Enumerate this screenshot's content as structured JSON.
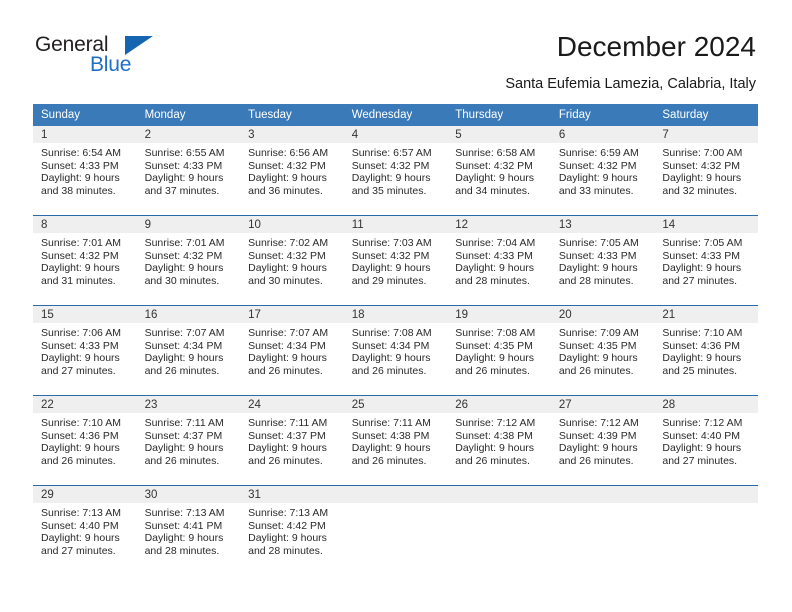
{
  "brand": {
    "name_top": "General",
    "name_bottom": "Blue",
    "triangle_color": "#1565b0",
    "text_color_top": "#231f20",
    "text_color_bottom": "#1f6fc4"
  },
  "header": {
    "title": "December 2024",
    "subtitle": "Santa Eufemia Lamezia, Calabria, Italy"
  },
  "theme": {
    "header_bg": "#3a7ab8",
    "header_text": "#ffffff",
    "daynum_band_bg": "#efefef",
    "row_divider": "#2b6ca8",
    "body_text": "#2a2a2a"
  },
  "weekdays": [
    "Sunday",
    "Monday",
    "Tuesday",
    "Wednesday",
    "Thursday",
    "Friday",
    "Saturday"
  ],
  "weeks": [
    [
      {
        "day": "1",
        "sunrise": "Sunrise: 6:54 AM",
        "sunset": "Sunset: 4:33 PM",
        "daylight1": "Daylight: 9 hours",
        "daylight2": "and 38 minutes."
      },
      {
        "day": "2",
        "sunrise": "Sunrise: 6:55 AM",
        "sunset": "Sunset: 4:33 PM",
        "daylight1": "Daylight: 9 hours",
        "daylight2": "and 37 minutes."
      },
      {
        "day": "3",
        "sunrise": "Sunrise: 6:56 AM",
        "sunset": "Sunset: 4:32 PM",
        "daylight1": "Daylight: 9 hours",
        "daylight2": "and 36 minutes."
      },
      {
        "day": "4",
        "sunrise": "Sunrise: 6:57 AM",
        "sunset": "Sunset: 4:32 PM",
        "daylight1": "Daylight: 9 hours",
        "daylight2": "and 35 minutes."
      },
      {
        "day": "5",
        "sunrise": "Sunrise: 6:58 AM",
        "sunset": "Sunset: 4:32 PM",
        "daylight1": "Daylight: 9 hours",
        "daylight2": "and 34 minutes."
      },
      {
        "day": "6",
        "sunrise": "Sunrise: 6:59 AM",
        "sunset": "Sunset: 4:32 PM",
        "daylight1": "Daylight: 9 hours",
        "daylight2": "and 33 minutes."
      },
      {
        "day": "7",
        "sunrise": "Sunrise: 7:00 AM",
        "sunset": "Sunset: 4:32 PM",
        "daylight1": "Daylight: 9 hours",
        "daylight2": "and 32 minutes."
      }
    ],
    [
      {
        "day": "8",
        "sunrise": "Sunrise: 7:01 AM",
        "sunset": "Sunset: 4:32 PM",
        "daylight1": "Daylight: 9 hours",
        "daylight2": "and 31 minutes."
      },
      {
        "day": "9",
        "sunrise": "Sunrise: 7:01 AM",
        "sunset": "Sunset: 4:32 PM",
        "daylight1": "Daylight: 9 hours",
        "daylight2": "and 30 minutes."
      },
      {
        "day": "10",
        "sunrise": "Sunrise: 7:02 AM",
        "sunset": "Sunset: 4:32 PM",
        "daylight1": "Daylight: 9 hours",
        "daylight2": "and 30 minutes."
      },
      {
        "day": "11",
        "sunrise": "Sunrise: 7:03 AM",
        "sunset": "Sunset: 4:32 PM",
        "daylight1": "Daylight: 9 hours",
        "daylight2": "and 29 minutes."
      },
      {
        "day": "12",
        "sunrise": "Sunrise: 7:04 AM",
        "sunset": "Sunset: 4:33 PM",
        "daylight1": "Daylight: 9 hours",
        "daylight2": "and 28 minutes."
      },
      {
        "day": "13",
        "sunrise": "Sunrise: 7:05 AM",
        "sunset": "Sunset: 4:33 PM",
        "daylight1": "Daylight: 9 hours",
        "daylight2": "and 28 minutes."
      },
      {
        "day": "14",
        "sunrise": "Sunrise: 7:05 AM",
        "sunset": "Sunset: 4:33 PM",
        "daylight1": "Daylight: 9 hours",
        "daylight2": "and 27 minutes."
      }
    ],
    [
      {
        "day": "15",
        "sunrise": "Sunrise: 7:06 AM",
        "sunset": "Sunset: 4:33 PM",
        "daylight1": "Daylight: 9 hours",
        "daylight2": "and 27 minutes."
      },
      {
        "day": "16",
        "sunrise": "Sunrise: 7:07 AM",
        "sunset": "Sunset: 4:34 PM",
        "daylight1": "Daylight: 9 hours",
        "daylight2": "and 26 minutes."
      },
      {
        "day": "17",
        "sunrise": "Sunrise: 7:07 AM",
        "sunset": "Sunset: 4:34 PM",
        "daylight1": "Daylight: 9 hours",
        "daylight2": "and 26 minutes."
      },
      {
        "day": "18",
        "sunrise": "Sunrise: 7:08 AM",
        "sunset": "Sunset: 4:34 PM",
        "daylight1": "Daylight: 9 hours",
        "daylight2": "and 26 minutes."
      },
      {
        "day": "19",
        "sunrise": "Sunrise: 7:08 AM",
        "sunset": "Sunset: 4:35 PM",
        "daylight1": "Daylight: 9 hours",
        "daylight2": "and 26 minutes."
      },
      {
        "day": "20",
        "sunrise": "Sunrise: 7:09 AM",
        "sunset": "Sunset: 4:35 PM",
        "daylight1": "Daylight: 9 hours",
        "daylight2": "and 26 minutes."
      },
      {
        "day": "21",
        "sunrise": "Sunrise: 7:10 AM",
        "sunset": "Sunset: 4:36 PM",
        "daylight1": "Daylight: 9 hours",
        "daylight2": "and 25 minutes."
      }
    ],
    [
      {
        "day": "22",
        "sunrise": "Sunrise: 7:10 AM",
        "sunset": "Sunset: 4:36 PM",
        "daylight1": "Daylight: 9 hours",
        "daylight2": "and 26 minutes."
      },
      {
        "day": "23",
        "sunrise": "Sunrise: 7:11 AM",
        "sunset": "Sunset: 4:37 PM",
        "daylight1": "Daylight: 9 hours",
        "daylight2": "and 26 minutes."
      },
      {
        "day": "24",
        "sunrise": "Sunrise: 7:11 AM",
        "sunset": "Sunset: 4:37 PM",
        "daylight1": "Daylight: 9 hours",
        "daylight2": "and 26 minutes."
      },
      {
        "day": "25",
        "sunrise": "Sunrise: 7:11 AM",
        "sunset": "Sunset: 4:38 PM",
        "daylight1": "Daylight: 9 hours",
        "daylight2": "and 26 minutes."
      },
      {
        "day": "26",
        "sunrise": "Sunrise: 7:12 AM",
        "sunset": "Sunset: 4:38 PM",
        "daylight1": "Daylight: 9 hours",
        "daylight2": "and 26 minutes."
      },
      {
        "day": "27",
        "sunrise": "Sunrise: 7:12 AM",
        "sunset": "Sunset: 4:39 PM",
        "daylight1": "Daylight: 9 hours",
        "daylight2": "and 26 minutes."
      },
      {
        "day": "28",
        "sunrise": "Sunrise: 7:12 AM",
        "sunset": "Sunset: 4:40 PM",
        "daylight1": "Daylight: 9 hours",
        "daylight2": "and 27 minutes."
      }
    ],
    [
      {
        "day": "29",
        "sunrise": "Sunrise: 7:13 AM",
        "sunset": "Sunset: 4:40 PM",
        "daylight1": "Daylight: 9 hours",
        "daylight2": "and 27 minutes."
      },
      {
        "day": "30",
        "sunrise": "Sunrise: 7:13 AM",
        "sunset": "Sunset: 4:41 PM",
        "daylight1": "Daylight: 9 hours",
        "daylight2": "and 28 minutes."
      },
      {
        "day": "31",
        "sunrise": "Sunrise: 7:13 AM",
        "sunset": "Sunset: 4:42 PM",
        "daylight1": "Daylight: 9 hours",
        "daylight2": "and 28 minutes."
      },
      {
        "day": "",
        "sunrise": "",
        "sunset": "",
        "daylight1": "",
        "daylight2": ""
      },
      {
        "day": "",
        "sunrise": "",
        "sunset": "",
        "daylight1": "",
        "daylight2": ""
      },
      {
        "day": "",
        "sunrise": "",
        "sunset": "",
        "daylight1": "",
        "daylight2": ""
      },
      {
        "day": "",
        "sunrise": "",
        "sunset": "",
        "daylight1": "",
        "daylight2": ""
      }
    ]
  ]
}
